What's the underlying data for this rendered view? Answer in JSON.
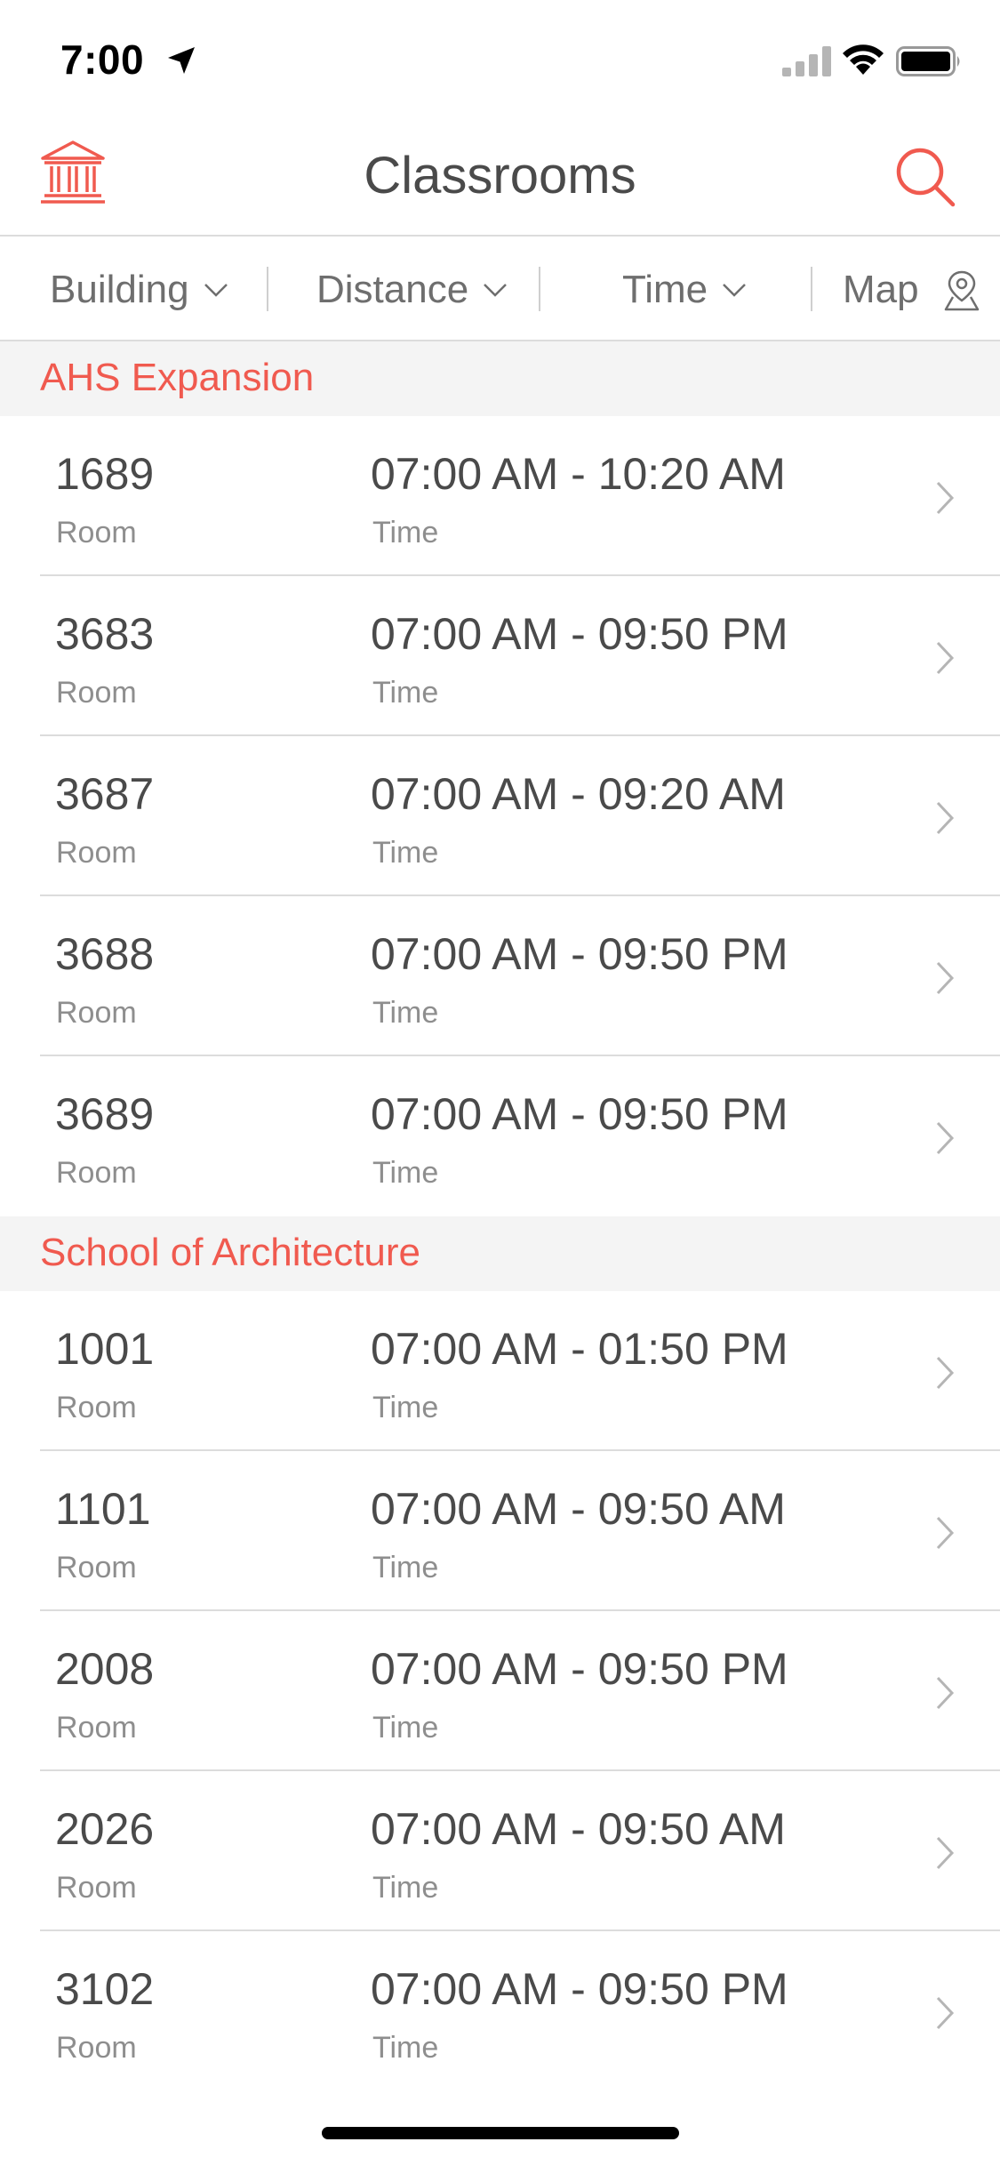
{
  "status_bar": {
    "time": "7:00"
  },
  "header": {
    "title": "Classrooms"
  },
  "filters": {
    "building": "Building",
    "distance": "Distance",
    "time": "Time",
    "map": "Map"
  },
  "colors": {
    "accent": "#f05a4f",
    "text": "#4a4a4a",
    "secondary": "#8e8e8e",
    "section_bg": "#f4f4f4"
  },
  "sections": [
    {
      "title": "AHS Expansion",
      "rows": [
        {
          "room": "1689",
          "room_label": "Room",
          "time": "07:00 AM - 10:20 AM",
          "time_label": "Time"
        },
        {
          "room": "3683",
          "room_label": "Room",
          "time": "07:00 AM - 09:50 PM",
          "time_label": "Time"
        },
        {
          "room": "3687",
          "room_label": "Room",
          "time": "07:00 AM - 09:20 AM",
          "time_label": "Time"
        },
        {
          "room": "3688",
          "room_label": "Room",
          "time": "07:00 AM - 09:50 PM",
          "time_label": "Time"
        },
        {
          "room": "3689",
          "room_label": "Room",
          "time": "07:00 AM - 09:50 PM",
          "time_label": "Time"
        }
      ]
    },
    {
      "title": "School of Architecture",
      "rows": [
        {
          "room": "1001",
          "room_label": "Room",
          "time": "07:00 AM - 01:50 PM",
          "time_label": "Time"
        },
        {
          "room": "1101",
          "room_label": "Room",
          "time": "07:00 AM - 09:50 AM",
          "time_label": "Time"
        },
        {
          "room": "2008",
          "room_label": "Room",
          "time": "07:00 AM - 09:50 PM",
          "time_label": "Time"
        },
        {
          "room": "2026",
          "room_label": "Room",
          "time": "07:00 AM - 09:50 AM",
          "time_label": "Time"
        },
        {
          "room": "3102",
          "room_label": "Room",
          "time": "07:00 AM - 09:50 PM",
          "time_label": "Time"
        }
      ]
    }
  ]
}
